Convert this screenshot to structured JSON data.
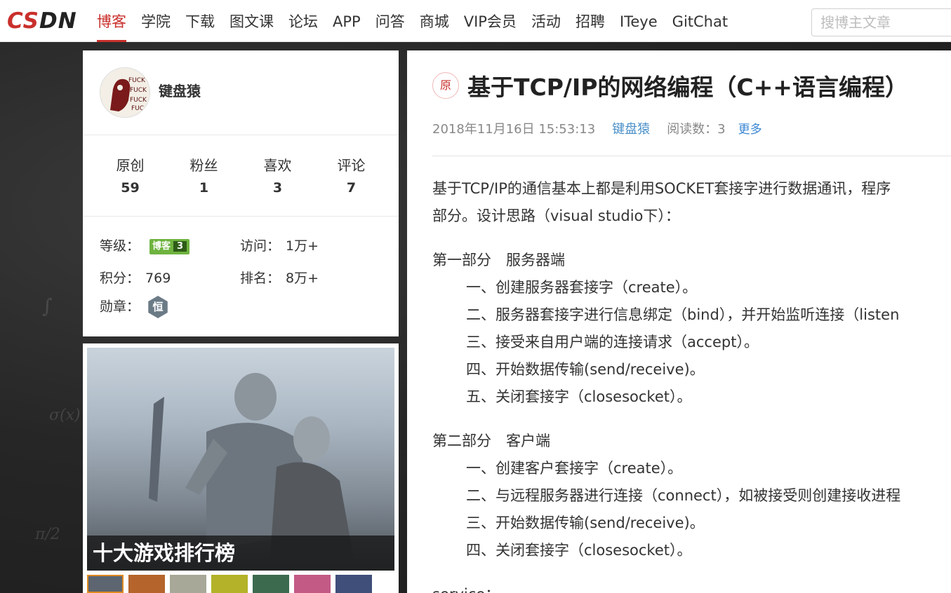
{
  "logo": {
    "text_cs": "CS",
    "text_dn": "DN"
  },
  "nav": {
    "items": [
      "博客",
      "学院",
      "下载",
      "图文课",
      "论坛",
      "APP",
      "问答",
      "商城",
      "VIP会员",
      "活动",
      "招聘",
      "ITeye",
      "GitChat"
    ],
    "active_index": 0
  },
  "search": {
    "placeholder": "搜博主文章"
  },
  "profile": {
    "username": "键盘猿",
    "stats": [
      {
        "label": "原创",
        "value": "59"
      },
      {
        "label": "粉丝",
        "value": "1"
      },
      {
        "label": "喜欢",
        "value": "3"
      },
      {
        "label": "评论",
        "value": "7"
      }
    ],
    "level_label": "等级：",
    "level_badge_text": "博客",
    "level_badge_num": "3",
    "visits_label": "访问：",
    "visits_value": "1万+",
    "points_label": "积分：",
    "points_value": "769",
    "rank_label": "排名：",
    "rank_value": "8万+",
    "medal_label": "勋章：",
    "medal_text": "恒",
    "avatar_text": "FUCK"
  },
  "ad": {
    "title": "十大游戏排行榜"
  },
  "article": {
    "badge": "原",
    "title": "基于TCP/IP的网络编程（C++语言编程）",
    "date": "2018年11月16日 15:53:13",
    "author": "键盘猿",
    "reads": "阅读数：3",
    "more": "更多",
    "paragraphs": {
      "intro1": "基于TCP/IP的通信基本上都是利用SOCKET套接字进行数据通讯，程序",
      "intro2": "部分。设计思路（visual studio下）：",
      "part1_title": "第一部分　服务器端",
      "part1_1": "一、创建服务器套接字（create）。",
      "part1_2": "二、服务器套接字进行信息绑定（bind），并开始监听连接（listen",
      "part1_3": "三、接受来自用户端的连接请求（accept）。",
      "part1_4": "四、开始数据传输(send/receive)。",
      "part1_5": "五、关闭套接字（closesocket）。",
      "part2_title": "第二部分　客户端",
      "part2_1": "一、创建客户套接字（create）。",
      "part2_2": "二、与远程服务器进行连接（connect），如被接受则创建接收进程",
      "part2_3": "三、开始数据传输(send/receive)。",
      "part2_4": "四、关闭套接字（closesocket）。",
      "service": "service："
    }
  },
  "colors": {
    "accent": "#c9302c",
    "link": "#4a90c8",
    "level_green": "#6fb33f"
  }
}
